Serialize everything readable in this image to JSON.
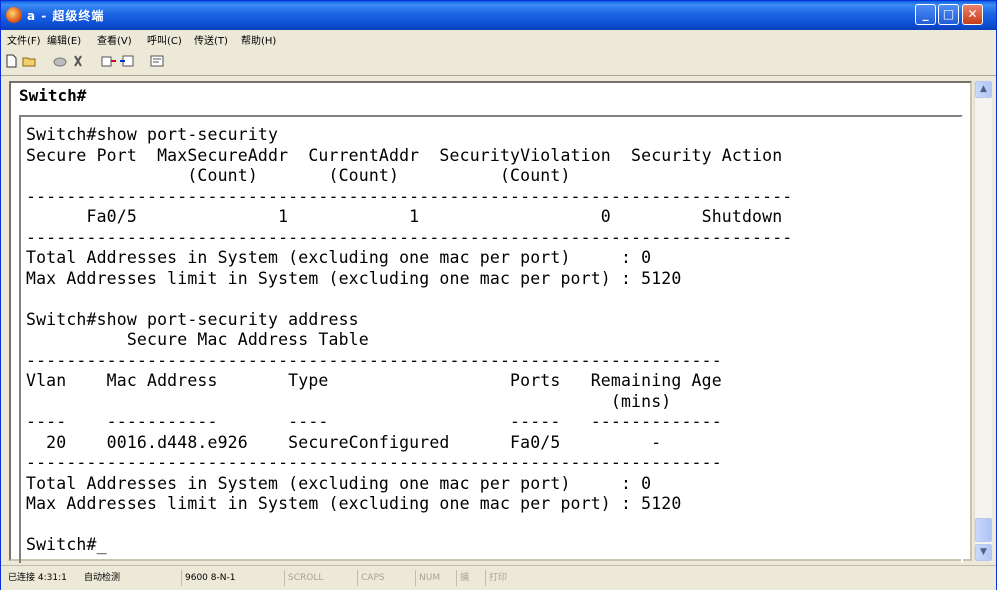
{
  "window": {
    "title": "a - 超级终端",
    "caption_buttons": {
      "minimize": "_",
      "maximize": "□",
      "close": "✕"
    }
  },
  "menu": [
    "文件(F)",
    "编辑(E)",
    "查看(V)",
    "呼叫(C)",
    "传送(T)",
    "帮助(H)"
  ],
  "toolbar": {
    "icons": [
      "new-icon",
      "open-icon",
      "call-icon",
      "disconnect-icon",
      "send-icon",
      "receive-icon",
      "properties-icon"
    ]
  },
  "terminal": {
    "top_prompt": "Switch#",
    "lines": [
      "Switch#show port-security",
      "Secure Port  MaxSecureAddr  CurrentAddr  SecurityViolation  Security Action",
      "                (Count)       (Count)          (Count)",
      "----------------------------------------------------------------------------",
      "      Fa0/5              1            1                  0         Shutdown",
      "----------------------------------------------------------------------------",
      "Total Addresses in System (excluding one mac per port)     : 0",
      "Max Addresses limit in System (excluding one mac per port) : 5120",
      "",
      "Switch#show port-security address",
      "          Secure Mac Address Table",
      "---------------------------------------------------------------------",
      "Vlan    Mac Address       Type                  Ports   Remaining Age",
      "                                                          (mins)",
      "----    -----------       ----                  -----   -------------",
      "  20    0016.d448.e926    SecureConfigured      Fa0/5         -",
      "---------------------------------------------------------------------",
      "Total Addresses in System (excluding one mac per port)     : 0",
      "Max Addresses limit in System (excluding one mac per port) : 5120",
      "",
      "Switch#_"
    ]
  },
  "statusbar": {
    "connection": "已连接 4:31:1",
    "detect": "自动检测",
    "settings": "9600 8-N-1",
    "scroll": "SCROLL",
    "caps": "CAPS",
    "num": "NUM",
    "capture": "捕",
    "print": "打印"
  }
}
